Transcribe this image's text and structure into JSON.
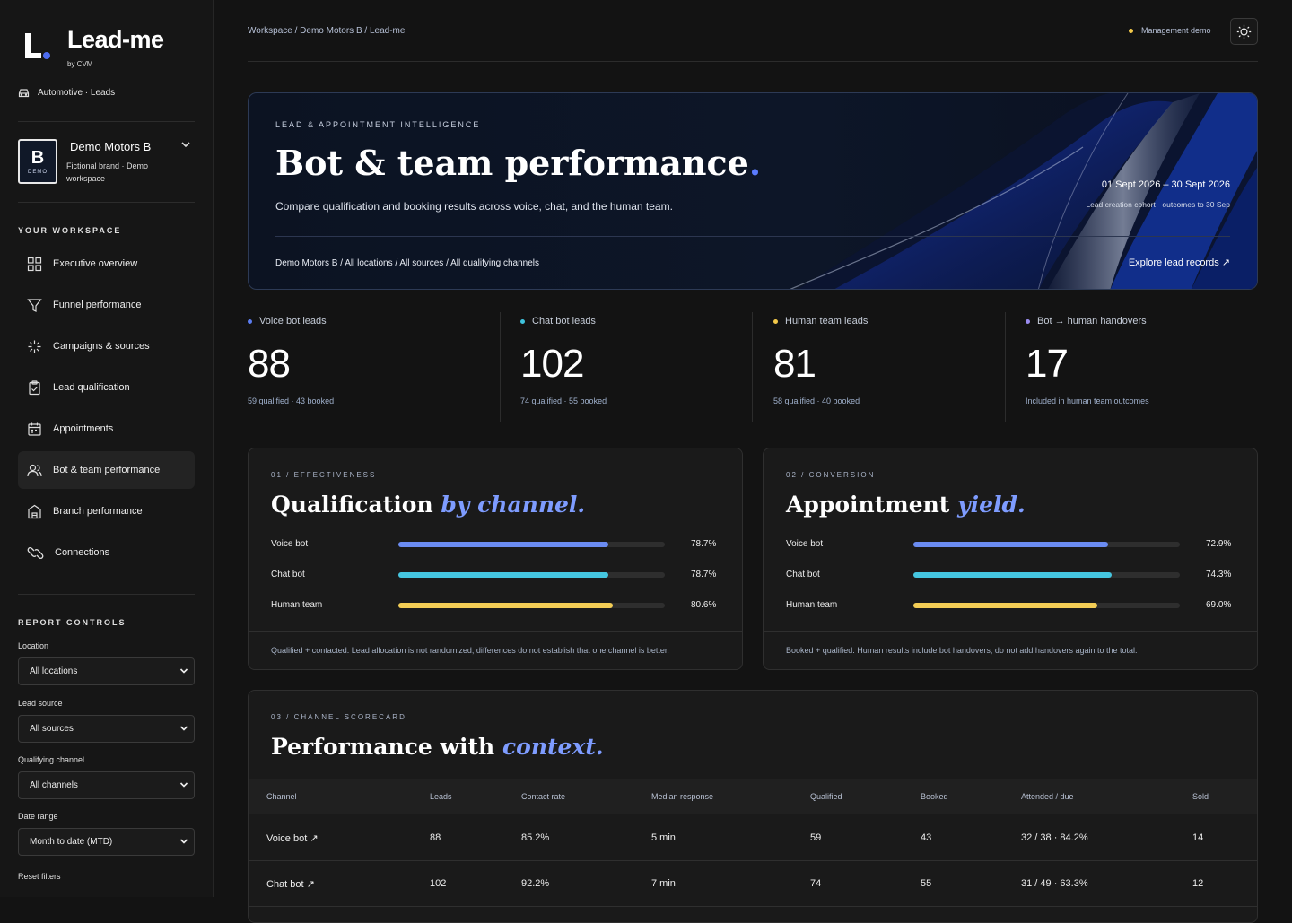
{
  "brand": {
    "name": "Lead-me",
    "by": "by CVM",
    "industry": "Automotive · Leads"
  },
  "workspace": {
    "badge_letter": "B",
    "badge_tag": "DEMO",
    "name": "Demo Motors B",
    "description": "Fictional brand · Demo workspace"
  },
  "nav": {
    "section_label": "YOUR WORKSPACE",
    "items": [
      {
        "label": "Executive overview",
        "icon": "grid-icon"
      },
      {
        "label": "Funnel performance",
        "icon": "funnel-icon"
      },
      {
        "label": "Campaigns & sources",
        "icon": "sparkle-icon"
      },
      {
        "label": "Lead qualification",
        "icon": "clipboard-check-icon"
      },
      {
        "label": "Appointments",
        "icon": "calendar-icon"
      },
      {
        "label": "Bot & team performance",
        "icon": "users-icon",
        "active": true
      },
      {
        "label": "Branch performance",
        "icon": "building-icon"
      },
      {
        "label": "Connections",
        "icon": "link-icon"
      }
    ]
  },
  "controls": {
    "section_label": "REPORT CONTROLS",
    "location": {
      "label": "Location",
      "value": "All locations"
    },
    "lead_source": {
      "label": "Lead source",
      "value": "All sources"
    },
    "qualifying_channel": {
      "label": "Qualifying channel",
      "value": "All channels"
    },
    "date_range": {
      "label": "Date range",
      "value": "Month to date (MTD)"
    },
    "reset": "Reset filters"
  },
  "header": {
    "breadcrumb": "Workspace / Demo Motors B / Lead-me",
    "mode_badge": "Management demo",
    "theme_icon": "sun-icon"
  },
  "hero": {
    "eyebrow": "LEAD & APPOINTMENT INTELLIGENCE",
    "title": "Bot & team performance",
    "title_dot": ".",
    "description": "Compare qualification and booking results across voice, chat, and the human team.",
    "date_range": "01 Sept 2026 – 30 Sept 2026",
    "cohort": "Lead creation cohort · outcomes to 30 Sep",
    "scope": "Demo Motors B / All locations / All sources / All qualifying channels",
    "link": "Explore lead records ↗"
  },
  "kpis": [
    {
      "label": "Voice bot leads",
      "value": "88",
      "sub": "59 qualified · 43 booked",
      "color": "#5b7cf0"
    },
    {
      "label": "Chat bot leads",
      "value": "102",
      "sub": "74 qualified · 55 booked",
      "color": "#3fc3dd"
    },
    {
      "label": "Human team leads",
      "value": "81",
      "sub": "58 qualified · 40 booked",
      "color": "#f3c94a"
    },
    {
      "label": "Bot → human handovers",
      "value": "17",
      "sub": "Included in human team outcomes",
      "color": "#9a8cf0"
    }
  ],
  "effectiveness": {
    "eyebrow": "01 / EFFECTIVENESS",
    "title": "Qualification",
    "title_em": "by channel.",
    "rows": [
      {
        "label": "Voice bot",
        "pct": "78.7%",
        "value": 0.787,
        "color": "#6b8cf2"
      },
      {
        "label": "Chat bot",
        "pct": "78.7%",
        "value": 0.787,
        "color": "#45c6e0"
      },
      {
        "label": "Human team",
        "pct": "80.6%",
        "value": 0.806,
        "color": "#f3cd55"
      }
    ],
    "note": "Qualified + contacted. Lead allocation is not randomized; differences do not establish that one channel is better."
  },
  "conversion": {
    "eyebrow": "02 / CONVERSION",
    "title": "Appointment",
    "title_em": "yield.",
    "rows": [
      {
        "label": "Voice bot",
        "pct": "72.9%",
        "value": 0.729,
        "color": "#6b8cf2"
      },
      {
        "label": "Chat bot",
        "pct": "74.3%",
        "value": 0.743,
        "color": "#45c6e0"
      },
      {
        "label": "Human team",
        "pct": "69.0%",
        "value": 0.69,
        "color": "#f3cd55"
      }
    ],
    "note": "Booked + qualified. Human results include bot handovers; do not add handovers again to the total."
  },
  "scorecard": {
    "eyebrow": "03 / CHANNEL SCORECARD",
    "title": "Performance with",
    "title_em": "context.",
    "columns": [
      "Channel",
      "Leads",
      "Contact rate",
      "Median response",
      "Qualified",
      "Booked",
      "Attended / due",
      "Sold"
    ],
    "rows": [
      [
        "Voice bot ↗",
        "88",
        "85.2%",
        "5 min",
        "59",
        "43",
        "32 / 38 · 84.2%",
        "14"
      ],
      [
        "Chat bot ↗",
        "102",
        "92.2%",
        "7 min",
        "74",
        "55",
        "31 / 49 · 63.3%",
        "12"
      ]
    ]
  }
}
